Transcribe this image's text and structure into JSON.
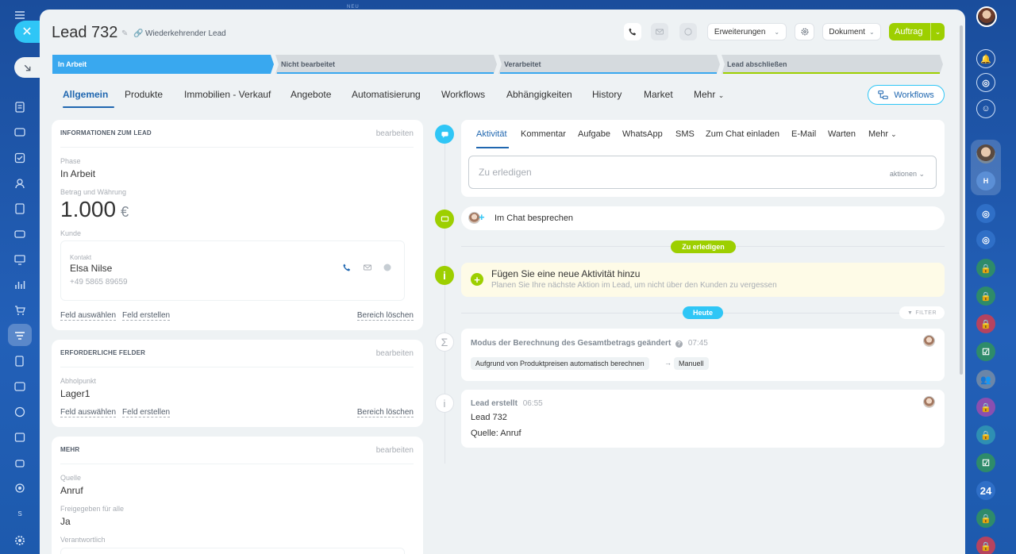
{
  "top_hint": "NEU",
  "lead": {
    "title": "Lead 732",
    "type": "Wiederkehrender Lead"
  },
  "header_buttons": {
    "erweiterungen": "Erweiterungen",
    "dokument": "Dokument",
    "auftrag": "Auftrag"
  },
  "stages": [
    {
      "label": "In Arbeit",
      "color": "#39a8ef"
    },
    {
      "label": "Nicht bearbeitet",
      "color": "#d5dade"
    },
    {
      "label": "Verarbeitet",
      "color": "#d5dade"
    },
    {
      "label": "Lead abschließen",
      "color": "#d5dade"
    }
  ],
  "tabs": [
    "Allgemein",
    "Produkte",
    "Immobilien - Verkauf",
    "Angebote",
    "Automatisierung",
    "Workflows",
    "Abhängigkeiten",
    "History",
    "Market",
    "Mehr"
  ],
  "workflows_button": "Workflows",
  "info_card": {
    "title": "INFORMATIONEN ZUM LEAD",
    "edit": "bearbeiten",
    "phase_label": "Phase",
    "phase_value": "In Arbeit",
    "amount_label": "Betrag und Währung",
    "amount": "1.000",
    "currency": "€",
    "customer_label": "Kunde",
    "contact_label": "Kontakt",
    "contact_name": "Elsa Nilse",
    "contact_phone": "+49 5865 89659",
    "link_select": "Feld auswählen",
    "link_create": "Feld erstellen",
    "link_clear": "Bereich löschen"
  },
  "required_card": {
    "title": "ERFORDERLICHE FELDER",
    "edit": "bearbeiten",
    "pickup_label": "Abholpunkt",
    "pickup_value": "Lager1",
    "link_select": "Feld auswählen",
    "link_create": "Feld erstellen",
    "link_clear": "Bereich löschen"
  },
  "more_card": {
    "title": "MEHR",
    "edit": "bearbeiten",
    "source_label": "Quelle",
    "source_value": "Anruf",
    "shared_label": "Freigegeben für alle",
    "shared_value": "Ja",
    "responsible_label": "Verantwortlich"
  },
  "activity": {
    "tabs": [
      "Aktivität",
      "Kommentar",
      "Aufgabe",
      "WhatsApp",
      "SMS",
      "Zum Chat einladen",
      "E-Mail",
      "Warten",
      "Mehr"
    ],
    "placeholder": "Zu erledigen",
    "actions": "aktionen"
  },
  "chat": {
    "label": "Im Chat besprechen"
  },
  "todo_pill": "Zu erledigen",
  "add_activity": {
    "title": "Fügen Sie eine neue Aktivität hinzu",
    "subtitle": "Planen Sie Ihre nächste Aktion im Lead, um nicht über den Kunden zu vergessen"
  },
  "today_pill": "Heute",
  "filter": "FILTER",
  "event_mode": {
    "title": "Modus der Berechnung des Gesamtbetrags geändert",
    "time": "07:45",
    "from": "Aufgrund von Produktpreisen automatisch berechnen",
    "to": "Manuell"
  },
  "event_created": {
    "title": "Lead erstellt",
    "time": "06:55",
    "line1": "Lead 732",
    "line2": "Quelle: Anruf"
  },
  "right_rail_number": "24",
  "colors": {
    "accent_blue": "#2067b0",
    "green": "#9dcf00",
    "cyan": "#2fc6f6",
    "stage_active": "#39a8ef"
  }
}
